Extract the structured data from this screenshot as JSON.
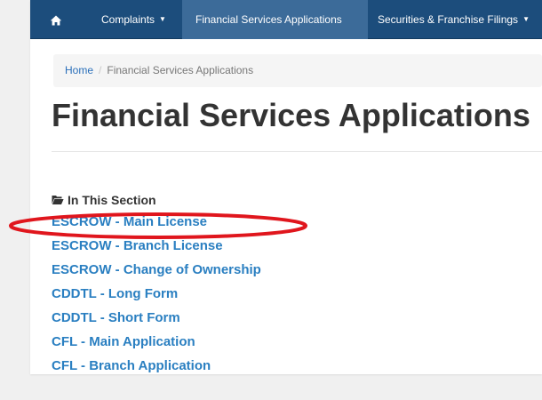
{
  "navbar": {
    "items": [
      {
        "label": "Complaints"
      },
      {
        "label": "Financial Services Applications",
        "active": true
      },
      {
        "label": "Securities & Franchise Filings"
      }
    ],
    "home_icon": "home-icon",
    "caret_glyph": "▼"
  },
  "breadcrumb": {
    "home": "Home",
    "separator": "/",
    "current": "Financial Services Applications"
  },
  "main": {
    "title": "Financial Services Applications",
    "section": {
      "icon": "folder-open-icon",
      "heading": "In This Section",
      "links": [
        {
          "label": "ESCROW - Main License"
        },
        {
          "label": "ESCROW - Branch License"
        },
        {
          "label": "ESCROW - Change of Ownership"
        },
        {
          "label": "CDDTL - Long Form"
        },
        {
          "label": "CDDTL - Short Form"
        },
        {
          "label": "CFL - Main Application"
        },
        {
          "label": "CFL - Branch Application"
        }
      ]
    }
  },
  "annotation": {
    "shape": "ellipse",
    "color": "#e0161d",
    "target": "ESCROW - Main License"
  },
  "colors": {
    "navbar": "#1c4d7c",
    "navbar_active": "#3c6b99",
    "link": "#2a7fc1",
    "title": "#333333"
  }
}
